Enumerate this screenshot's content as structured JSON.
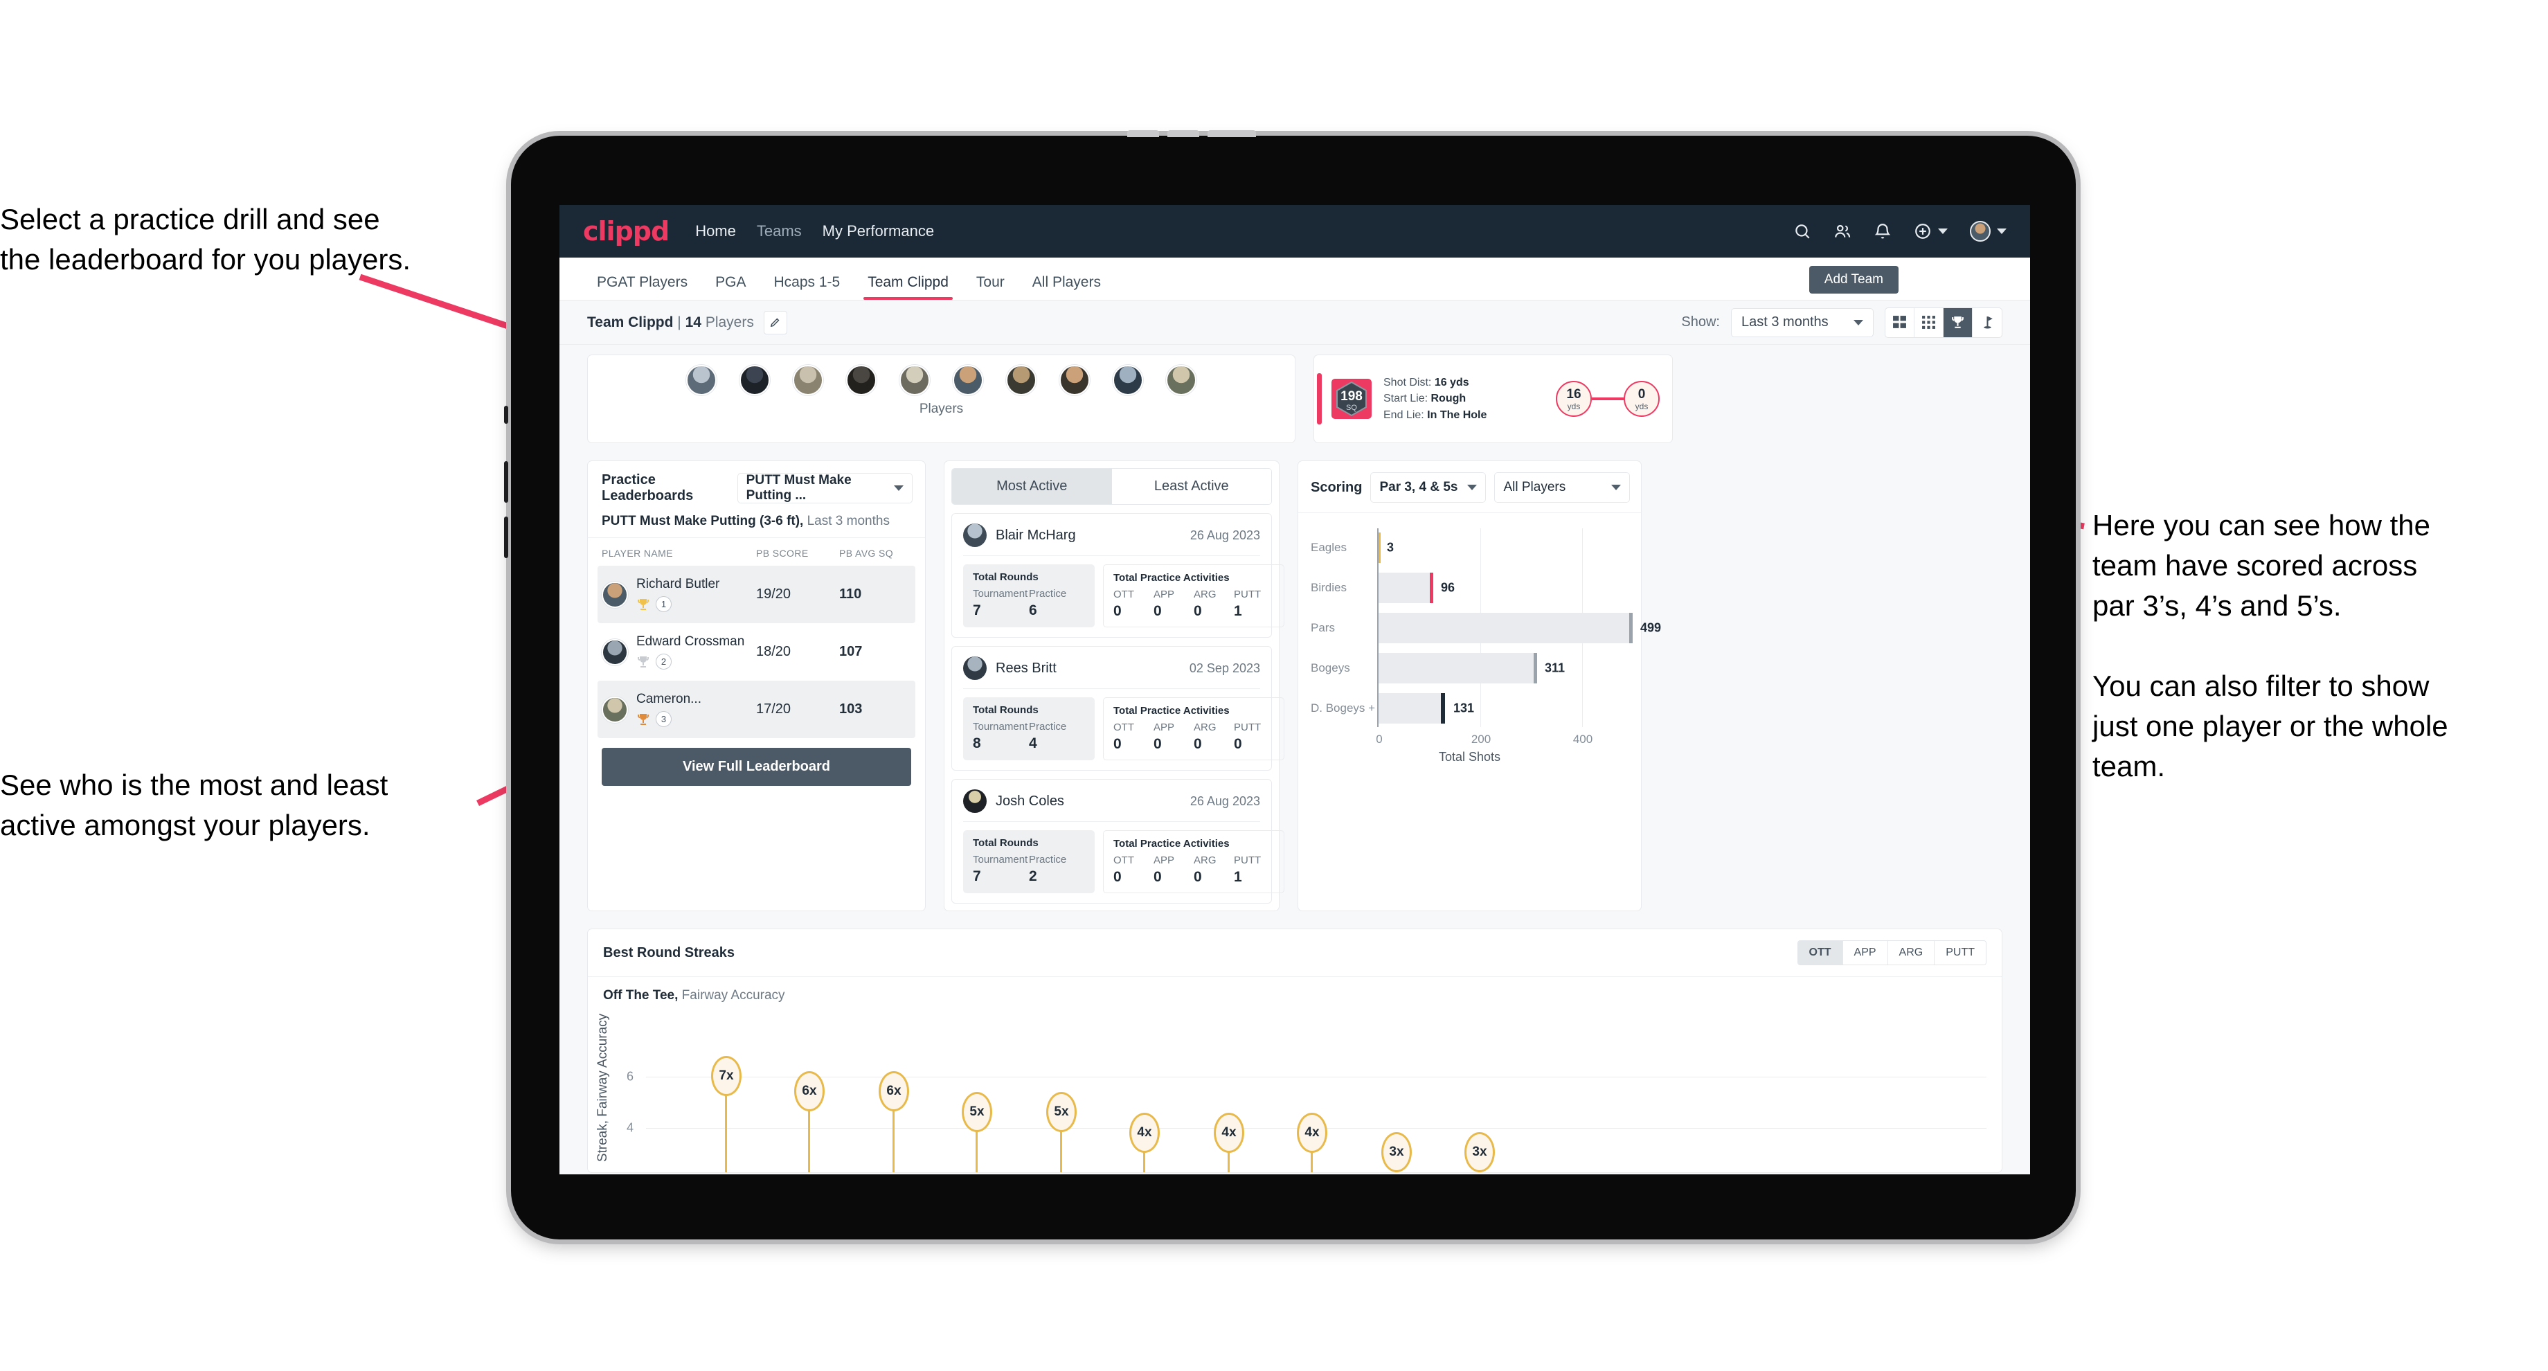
{
  "annotations": {
    "left_top": "Select a practice drill and see\nthe leaderboard for you players.",
    "left_bottom": "See who is the most and least\nactive amongst your players.",
    "right": "Here you can see how the\nteam have scored across\npar 3’s, 4’s and 5’s.\n\nYou can also filter to show\njust one player or the whole\nteam."
  },
  "colors": {
    "brand_pink": "#ec3a62",
    "nav_dark": "#1b2836",
    "slate": "#4c5966",
    "gold": "#e8b94b"
  },
  "topnav": {
    "logo": "clippd",
    "links": [
      {
        "label": "Home",
        "active": true
      },
      {
        "label": "Teams",
        "active": false
      },
      {
        "label": "My Performance",
        "active": true
      }
    ],
    "icons": [
      "search-icon",
      "people-icon",
      "bell-icon",
      "plus-circle-icon",
      "avatar"
    ]
  },
  "tabs": {
    "items": [
      {
        "label": "PGAT Players",
        "active": false
      },
      {
        "label": "PGA",
        "active": false
      },
      {
        "label": "Hcaps 1-5",
        "active": false
      },
      {
        "label": "Team Clippd",
        "active": true
      },
      {
        "label": "Tour",
        "active": false
      },
      {
        "label": "All Players",
        "active": false
      }
    ],
    "add_team_label": "Add Team"
  },
  "subheader": {
    "team_name": "Team Clippd",
    "separator": "|",
    "player_count": "14",
    "players_word": "Players",
    "show_label": "Show:",
    "range_value": "Last 3 months",
    "view_modes": [
      "grid-large-icon",
      "grid-small-icon",
      "trophy-icon",
      "flag-icon"
    ],
    "active_view_index": 2
  },
  "players_card": {
    "label": "Players",
    "avatar_count": 10
  },
  "shot_card": {
    "sq_value": "198",
    "sq_label": "SQ",
    "lines": [
      {
        "label": "Shot Dist:",
        "value": "16 yds"
      },
      {
        "label": "Start Lie:",
        "value": "Rough"
      },
      {
        "label": "End Lie:",
        "value": "In The Hole"
      }
    ],
    "start_dist": {
      "value": "16",
      "unit": "yds"
    },
    "end_dist": {
      "value": "0",
      "unit": "yds"
    }
  },
  "practice_leaderboards": {
    "title": "Practice Leaderboards",
    "drill_select": "PUTT Must Make Putting ...",
    "subtitle_bold": "PUTT Must Make Putting (3-6 ft),",
    "subtitle_rest": "Last 3 months",
    "columns": [
      "PLAYER NAME",
      "PB SCORE",
      "PB AVG SQ"
    ],
    "rows": [
      {
        "name": "Richard Butler",
        "rank": "1",
        "score": "19/20",
        "sq": "110",
        "highlight": true,
        "trophy": "gold"
      },
      {
        "name": "Edward Crossman",
        "rank": "2",
        "score": "18/20",
        "sq": "107",
        "highlight": false,
        "trophy": "silver"
      },
      {
        "name": "Cameron...",
        "rank": "3",
        "score": "17/20",
        "sq": "103",
        "highlight": true,
        "trophy": "bronze"
      }
    ],
    "button_label": "View Full Leaderboard"
  },
  "activity": {
    "tabs": [
      {
        "label": "Most Active",
        "active": true
      },
      {
        "label": "Least Active",
        "active": false
      }
    ],
    "rounds_title": "Total Rounds",
    "rounds_headers": [
      "Tournament",
      "Practice"
    ],
    "activities_title": "Total Practice Activities",
    "activities_headers": [
      "OTT",
      "APP",
      "ARG",
      "PUTT"
    ],
    "cards": [
      {
        "name": "Blair McHarg",
        "date": "26 Aug 2023",
        "rounds": [
          "7",
          "6"
        ],
        "activities": [
          "0",
          "0",
          "0",
          "1"
        ]
      },
      {
        "name": "Rees Britt",
        "date": "02 Sep 2023",
        "rounds": [
          "8",
          "4"
        ],
        "activities": [
          "0",
          "0",
          "0",
          "0"
        ]
      },
      {
        "name": "Josh Coles",
        "date": "26 Aug 2023",
        "rounds": [
          "7",
          "2"
        ],
        "activities": [
          "0",
          "0",
          "0",
          "1"
        ]
      }
    ]
  },
  "scoring": {
    "title": "Scoring",
    "par_filter": "Par 3, 4 & 5s",
    "player_filter": "All Players"
  },
  "best_round_streaks": {
    "title": "Best Round Streaks",
    "segments": [
      {
        "label": "OTT",
        "active": true
      },
      {
        "label": "APP",
        "active": false
      },
      {
        "label": "ARG",
        "active": false
      },
      {
        "label": "PUTT",
        "active": false
      }
    ],
    "subtitle_bold": "Off The Tee,",
    "subtitle_rest": "Fairway Accuracy"
  },
  "chart_data": [
    {
      "type": "bar",
      "orientation": "horizontal",
      "title": "Scoring",
      "categories": [
        "Eagles",
        "Birdies",
        "Pars",
        "Bogeys",
        "D. Bogeys +"
      ],
      "values": [
        3,
        96,
        499,
        311,
        131
      ],
      "bar_cap_colors": [
        "#e8b94b",
        "#ec3a62",
        "#9aa3ac",
        "#9aa3ac",
        "#1f2b37"
      ],
      "xlabel": "Total Shots",
      "ylabel": "",
      "xticks": [
        0,
        200,
        400
      ],
      "xlim": [
        0,
        540
      ],
      "grid": true,
      "legend": "none"
    },
    {
      "type": "scatter",
      "title": "Best Round Streaks",
      "subtitle": "Off The Tee, Fairway Accuracy",
      "ylabel": "Streak, Fairway Accuracy",
      "xlabel": "",
      "yticks": [
        4,
        6
      ],
      "ylim": [
        0,
        8
      ],
      "labels": [
        "7x",
        "6x",
        "6x",
        "5x",
        "5x",
        "4x",
        "4x",
        "4x",
        "3x",
        "3x"
      ],
      "values": [
        7,
        6,
        6,
        5,
        5,
        4,
        4,
        4,
        3,
        3
      ],
      "grid": true,
      "legend": "none"
    }
  ]
}
